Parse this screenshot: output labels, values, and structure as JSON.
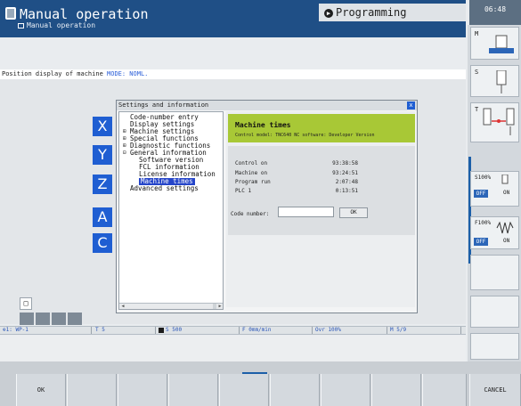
{
  "header": {
    "mode_title": "Manual operation",
    "mode_subtitle": "Manual operation",
    "program_tab": "Programming",
    "clock": "06:48"
  },
  "status_line": {
    "prefix": "Position display of machine ",
    "mode": "MODE: NOML."
  },
  "axes": [
    "X",
    "Y",
    "Z",
    "A",
    "C"
  ],
  "dialog": {
    "title": "Settings and information",
    "close": "x",
    "tree": [
      {
        "label": "Code-number entry",
        "expander": ""
      },
      {
        "label": "Display settings",
        "expander": ""
      },
      {
        "label": "Machine settings",
        "expander": "⊞"
      },
      {
        "label": "Special functions",
        "expander": "⊞"
      },
      {
        "label": "Diagnostic functions",
        "expander": "⊞"
      },
      {
        "label": "General information",
        "expander": "⊟"
      },
      {
        "label": "Software version",
        "expander": ""
      },
      {
        "label": "FCL information",
        "expander": ""
      },
      {
        "label": "License information",
        "expander": ""
      },
      {
        "label": "Machine times",
        "expander": ""
      },
      {
        "label": "Advanced settings",
        "expander": ""
      }
    ],
    "panel": {
      "title": "Machine times",
      "subtitle": "Control model: TNC640 NC software: Developer Version",
      "times": [
        {
          "label": "Control on",
          "value": "93:38:58"
        },
        {
          "label": "Machine on",
          "value": "93:24:51"
        },
        {
          "label": "Program run",
          "value": "2:07:48"
        },
        {
          "label": "PLC 1",
          "value": "0:13:51"
        }
      ],
      "code_label": "Code number:",
      "code_value": "",
      "ok_label": "OK"
    }
  },
  "status_bar": {
    "wp": "1: WP-1",
    "tool": "T 5",
    "spindle": "S 500",
    "feed": "F 0mm/min",
    "override": "Ovr 100%",
    "misc": "M 5/9"
  },
  "right_panel": {
    "m_letter": "M",
    "s_letter": "S",
    "t_letter": "T",
    "s_override": {
      "label": "S100%",
      "off": "OFF",
      "on": "ON"
    },
    "f_override": {
      "label": "F100%",
      "off": "OFF",
      "on": "ON"
    }
  },
  "softkeys": [
    "OK",
    "",
    "",
    "",
    "",
    "",
    "",
    "",
    "",
    "CANCEL"
  ],
  "colors": {
    "header_blue": "#1f4f86",
    "axis_blue": "#1f5ed2",
    "header_green": "#a8c836",
    "selection": "#2545c9"
  },
  "icons": [
    "camera-icon",
    "home-icon",
    "programming-icon",
    "close-icon",
    "restore-icon",
    "reference-icon",
    "spindle-icon",
    "tool-icon",
    "spring-icon",
    "dial-icon"
  ]
}
